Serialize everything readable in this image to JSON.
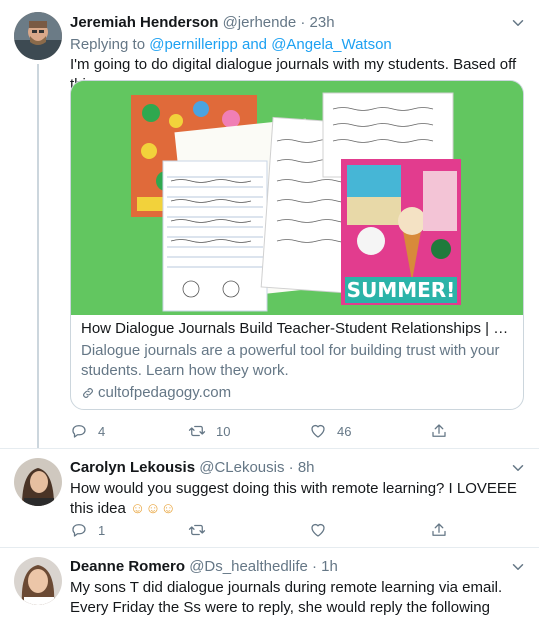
{
  "tweets": [
    {
      "name": "Jeremiah Henderson",
      "handle": "@jerhende",
      "time": "· 23h",
      "replying_prefix": "Replying to ",
      "replying_user1": "@pernilleripp",
      "replying_and": " and ",
      "replying_user2": "@Angela_Watson",
      "text": "I'm going to do digital dialogue journals with my students. Based off this:",
      "card": {
        "title": "How Dialogue Journals Build Teacher-Student Relationships | Cult of ...",
        "description": "Dialogue journals are a powerful tool for building trust with your students. Learn how they work.",
        "domain": "cultofpedagogy.com",
        "image_text": "SUMMER!"
      },
      "actions": {
        "reply": "4",
        "retweet": "10",
        "like": "46",
        "share": ""
      }
    },
    {
      "name": "Carolyn Lekousis",
      "handle": "@CLekousis",
      "time": "· 8h",
      "text": "How would you suggest doing this with remote learning? I LOVEEE this idea",
      "emoji": "☺☺☺",
      "actions": {
        "reply": "1",
        "retweet": "",
        "like": "",
        "share": ""
      }
    },
    {
      "name": "Deanne Romero",
      "handle": "@Ds_healthedlife",
      "time": "· 1h",
      "text": "My sons T did dialogue journals during remote learning via email. Every Friday the Ss were to reply, she would reply the following week."
    }
  ],
  "icons": {
    "reply": "reply-icon",
    "retweet": "retweet-icon",
    "like": "heart-icon",
    "share": "share-icon",
    "more": "chevron-down-icon",
    "link": "link-icon"
  },
  "colors": {
    "link": "#1da1f2",
    "secondary_text": "#657786",
    "card_image_bg": "#62c660",
    "divider": "#e6ecf0"
  }
}
